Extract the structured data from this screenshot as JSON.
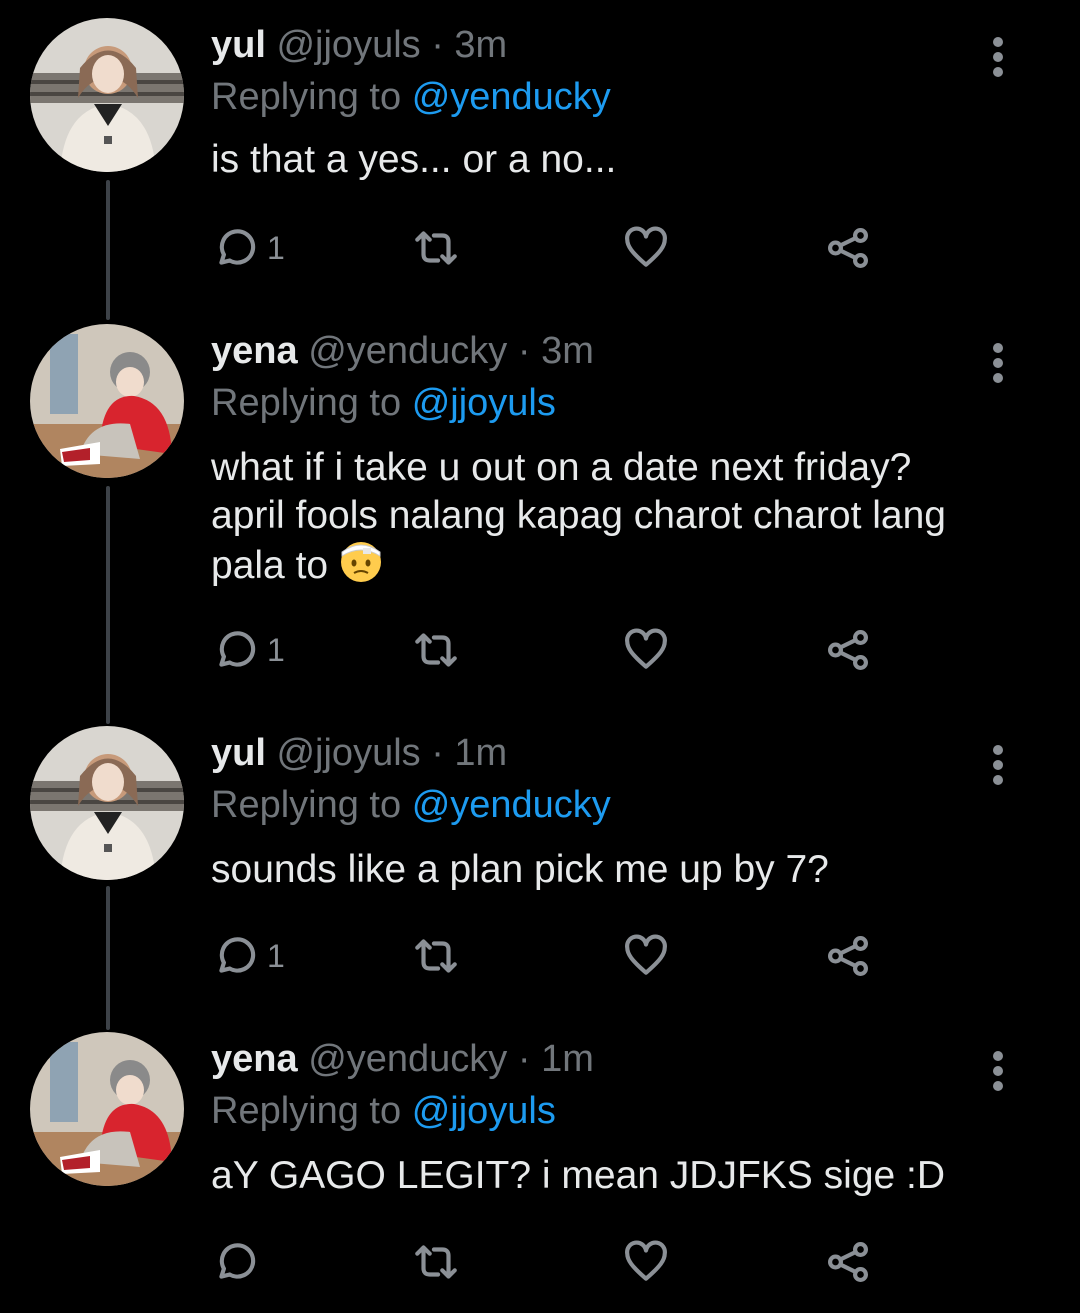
{
  "tweets": [
    {
      "name": "yul",
      "handle": "@jjoyuls",
      "sep": "·",
      "time": "3m",
      "replying_prefix": "Replying to",
      "replying_to": "@yenducky",
      "text": "is that a yes... or a no...",
      "reply_count": "1",
      "avatar": "avatar-yul"
    },
    {
      "name": "yena",
      "handle": "@yenducky",
      "sep": "·",
      "time": "3m",
      "replying_prefix": "Replying to",
      "replying_to": "@jjoyuls",
      "text_lines": [
        "what if i take u out on a date next friday?",
        "april fools nalang kapag charot charot lang",
        "pala to"
      ],
      "emoji": "face-with-head-bandage-icon",
      "reply_count": "1",
      "avatar": "avatar-yena"
    },
    {
      "name": "yul",
      "handle": "@jjoyuls",
      "sep": "·",
      "time": "1m",
      "replying_prefix": "Replying to",
      "replying_to": "@yenducky",
      "text": "sounds like a plan pick me up by 7?",
      "reply_count": "1",
      "avatar": "avatar-yul"
    },
    {
      "name": "yena",
      "handle": "@yenducky",
      "sep": "·",
      "time": "1m",
      "replying_prefix": "Replying to",
      "replying_to": "@jjoyuls",
      "text": "aY GAGO LEGIT? i mean JDJFKS sige :D",
      "reply_count": "",
      "avatar": "avatar-yena"
    }
  ],
  "colors": {
    "background": "#000000",
    "text": "#e7e9ea",
    "muted": "#71767b",
    "mention": "#1d9bf0",
    "icon": "#8b9096",
    "thread_line": "#3d4248"
  },
  "icons": [
    "reply-icon",
    "retweet-icon",
    "like-icon",
    "share-icon",
    "more-options-icon"
  ]
}
